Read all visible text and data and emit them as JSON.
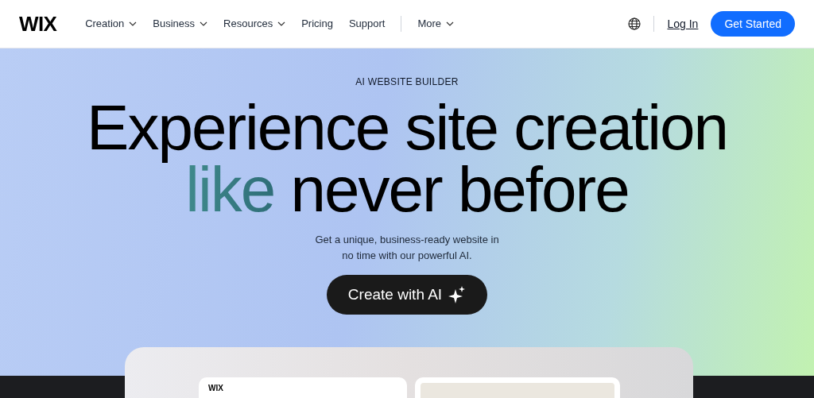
{
  "header": {
    "logo": "WIX",
    "nav": [
      {
        "label": "Creation",
        "has_dropdown": true
      },
      {
        "label": "Business",
        "has_dropdown": true
      },
      {
        "label": "Resources",
        "has_dropdown": true
      },
      {
        "label": "Pricing",
        "has_dropdown": false
      },
      {
        "label": "Support",
        "has_dropdown": false
      },
      {
        "label": "More",
        "has_dropdown": true
      }
    ],
    "login": "Log In",
    "cta": "Get Started"
  },
  "hero": {
    "eyebrow": "AI WEBSITE BUILDER",
    "headline_line_1": "Experience site creation",
    "headline_accent": "like",
    "headline_line_2": "never before",
    "subtitle": "Get a unique, business-ready website in no time with our powerful AI.",
    "button": "Create with AI"
  },
  "preview": {
    "left_card_logo": "WIX"
  }
}
